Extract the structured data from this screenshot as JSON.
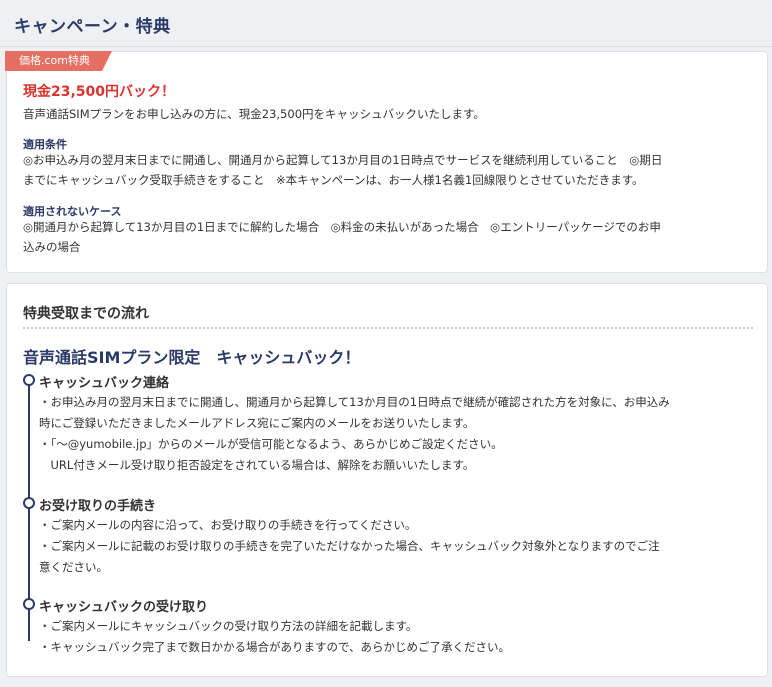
{
  "header": {
    "title": "キャンペーン・特典"
  },
  "campaign": {
    "tag": "価格.com特典",
    "title": "現金23,500円バック！",
    "description": "音声通話SIMプランをお申し込みの方に、現金23,500円をキャッシュバックいたします。",
    "conditions_label": "適用条件",
    "conditions_line1": "◎お申込み月の翌月末日までに開通し、開通月から起算して13か月目の1日時点でサービスを継続利用していること　◎期日",
    "conditions_line2": "までにキャッシュバック受取手続きをすること　※本キャンペーンは、お一人様1名義1回線限りとさせていただきます。",
    "exclusions_label": "適用されないケース",
    "exclusions_line1": "◎開通月から起算して13か月目の1日までに解約した場合　◎料金の未払いがあった場合　◎エントリーパッケージでのお申",
    "exclusions_line2": "込みの場合"
  },
  "flow": {
    "title": "特典受取までの流れ",
    "plan_title": "音声通話SIMプラン限定　キャッシュバック！",
    "steps": [
      {
        "heading": "キャッシュバック連絡",
        "lines": [
          "・お申込み月の翌月末日までに開通し、開通月から起算して13か月目の1日時点で継続が確認された方を対象に、お申込み",
          "時にご登録いただきましたメールアドレス宛にご案内のメールをお送りいたします。",
          "・「〜@yumobile.jp」からのメールが受信可能となるよう、あらかじめご設定ください。",
          "　URL付きメール受け取り拒否設定をされている場合は、解除をお願いいたします。"
        ]
      },
      {
        "heading": "お受け取りの手続き",
        "lines": [
          "・ご案内メールの内容に沿って、お受け取りの手続きを行ってください。",
          "・ご案内メールに記載のお受け取りの手続きを完了いただけなかった場合、キャッシュバック対象外となりますのでご注",
          "意ください。"
        ]
      },
      {
        "heading": "キャッシュバックの受け取り",
        "lines": [
          "・ご案内メールにキャッシュバックの受け取り方法の詳細を記載します。",
          "・キャッシュバック完了まで数日かかる場合がありますので、あらかじめご了承ください。"
        ]
      }
    ]
  },
  "colors": {
    "navy": "#2b3a67",
    "red": "#d8332c",
    "tag": "#e56f63"
  }
}
